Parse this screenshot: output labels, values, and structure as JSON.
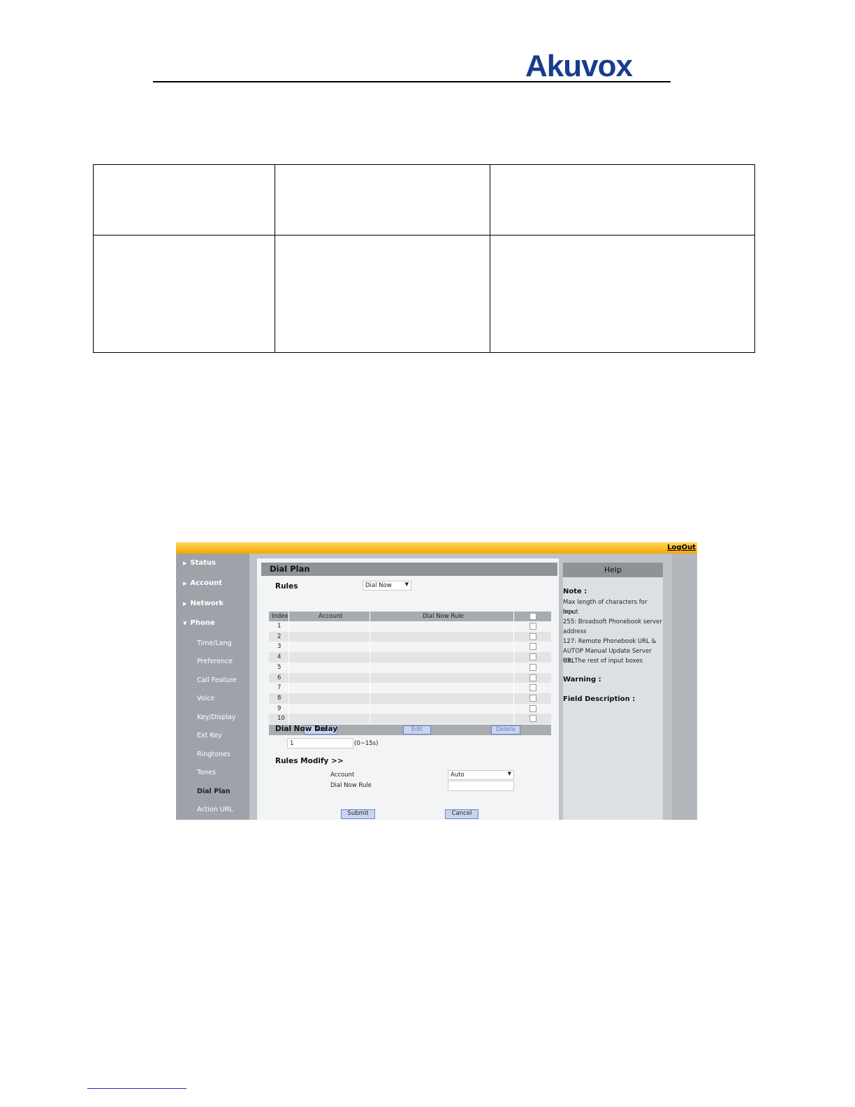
{
  "header": {
    "logo_text": "Akuvox"
  },
  "screenshot": {
    "logout": "LogOut",
    "sidebar": {
      "items": [
        "Status",
        "Account",
        "Network",
        "Phone"
      ],
      "sub_items": [
        "Time/Lang",
        "Preference",
        "Call Feature",
        "Voice",
        "Key/Display",
        "Ext Key",
        "Ringtones",
        "Tones",
        "Dial Plan",
        "Action URL"
      ],
      "active": "Dial Plan"
    },
    "main": {
      "title": "Dial Plan",
      "rules_label": "Rules",
      "rules_select": "Dial Now",
      "columns": [
        "Index",
        "Account",
        "Dial Now Rule"
      ],
      "rows": [
        "1",
        "2",
        "3",
        "4",
        "5",
        "6",
        "7",
        "8",
        "9",
        "10"
      ],
      "buttons": {
        "add": "Add",
        "edit": "Edit",
        "delete": "Delete"
      },
      "delay_label": "Dial Now Delay",
      "delay_value": "1",
      "delay_range": "(0~15s)",
      "modify_label": "Rules Modify >>",
      "account_label": "Account",
      "account_value": "Auto",
      "rule_label": "Dial Now Rule",
      "rule_value": "",
      "submit": "Submit",
      "cancel": "Cancel"
    },
    "help": {
      "title": "Help",
      "note_label": "Note :",
      "note_lines": [
        "Max length of characters for input",
        "box:",
        "255: Broadsoft Phonebook server",
        "address",
        "127: Remote Phonebook URL &",
        "AUTOP Manual Update Server URL",
        "63: The rest of input boxes"
      ],
      "warning_label": "Warning :",
      "field_label": "Field Description :"
    }
  },
  "colors": {
    "brand": "#1a3c8f",
    "topbar": "#f7a800"
  }
}
